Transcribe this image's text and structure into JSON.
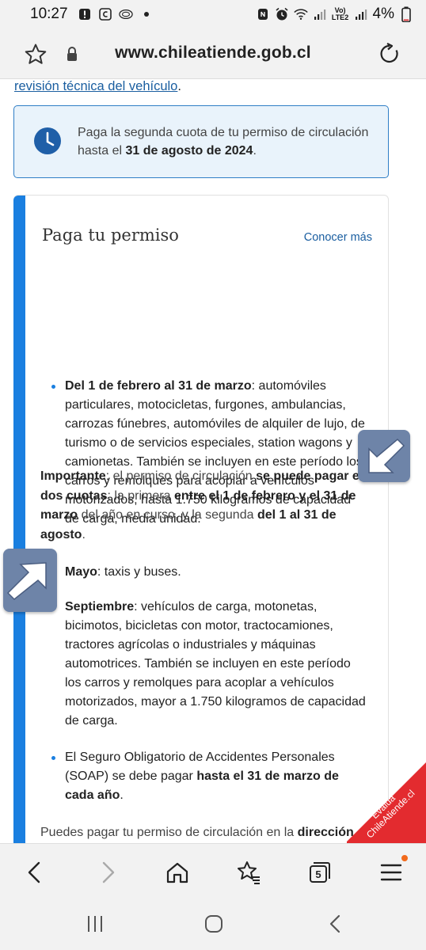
{
  "status_bar": {
    "time": "10:27",
    "battery": "4%",
    "network_label": "Vo) LTE2",
    "icons": [
      "alert-icon",
      "app-c-icon",
      "app-cloud-icon",
      "dot-icon",
      "nfc-icon",
      "alarm-icon",
      "wifi-icon",
      "signal-icon",
      "battery-icon"
    ]
  },
  "browser": {
    "url": "www.chileatiende.gob.cl"
  },
  "page": {
    "top_link": "revisión técnica del vehículo",
    "top_link_suffix": ".",
    "notice": {
      "text_before": "Paga la segunda cuota de tu permiso de circulación hasta el ",
      "text_bold": "31 de agosto de 2024",
      "text_after": "."
    },
    "card": {
      "title": "Paga tu permiso",
      "more_link": "Conocer más",
      "item1": {
        "bold": "Del 1 de febrero al 31 de marzo",
        "text": ": automóviles particulares, motocicletas, furgones, ambulancias, carrozas fúnebres, automóviles de alquiler de lujo, de turismo o de servicios especiales, station wagons y camionetas. También se incluyen en este período los carros y remolques para acoplar a vehículos motorizados, hasta 1.750 kilogramos de capacidad de carga, media unidad."
      },
      "important": {
        "b1": "Importante",
        "t1": ": el permiso de circulación ",
        "b2": "se puede pagar en dos cuotas",
        "t2": ": la primera ",
        "b3": "entre el 1 de febrero y el 31 de marzo",
        "t3": " del año en curso, y la segunda ",
        "b4": "del 1 al 31 de agosto",
        "t4": "."
      },
      "item2": {
        "bold": "Mayo",
        "text": ": taxis y buses."
      },
      "item3": {
        "bold": "Septiembre",
        "text": ": vehículos de carga, motonetas, bicimotos, bicicletas con motor, tractocamiones, tractores agrícolas o industriales y máquinas automotrices. También se incluyen en este período los carros y remolques para acoplar a vehículos motorizados, mayor a 1.750 kilogramos de capacidad de carga."
      },
      "item4": {
        "text": "El Seguro Obligatorio de Accidentes Personales (SOAP) se debe pagar ",
        "bold": "hasta el 31 de marzo de cada año",
        "after": "."
      },
      "footer": {
        "text": "Puedes pagar tu permiso de circulación en la ",
        "bold": "dirección"
      }
    },
    "ribbon": {
      "line1": "Evalúa",
      "line2": "ChileAtiende.cl"
    }
  },
  "toolbar": {
    "tabs_count": "5"
  },
  "colors": {
    "accent_blue": "#1a7fe0",
    "link_blue": "#1a5ea0",
    "notice_bg": "#e9f3fb",
    "ribbon_red": "#e32b2f",
    "arrow_gray_blue": "#6e84a8"
  }
}
